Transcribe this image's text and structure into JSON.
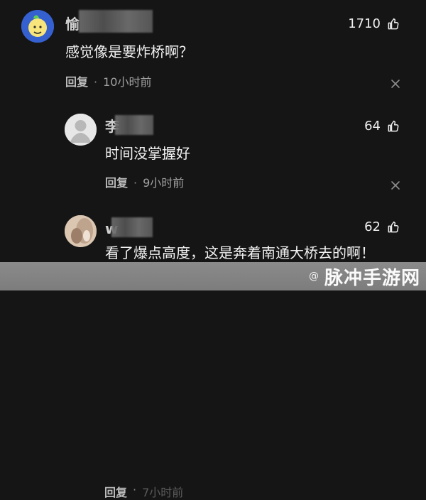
{
  "comments": [
    {
      "name_visible": "愉",
      "likes": "1710",
      "text": "感觉像是要炸桥啊？",
      "reply": "回复",
      "separator": "·",
      "time": "10小时前"
    },
    {
      "name_visible": "李",
      "likes": "64",
      "text": "时间没掌握好",
      "reply": "回复",
      "separator": "·",
      "time": "9小时前"
    },
    {
      "name_visible": "w",
      "likes": "62",
      "text": "看了爆点高度，这是奔着南通大桥去的啊！",
      "reply": "回复",
      "separator": "·",
      "time": "7小时前"
    }
  ],
  "watermark": {
    "small": "@",
    "large": "脉冲手游网"
  },
  "icons": {
    "like": "thumbs-up-icon",
    "close": "close-icon"
  }
}
